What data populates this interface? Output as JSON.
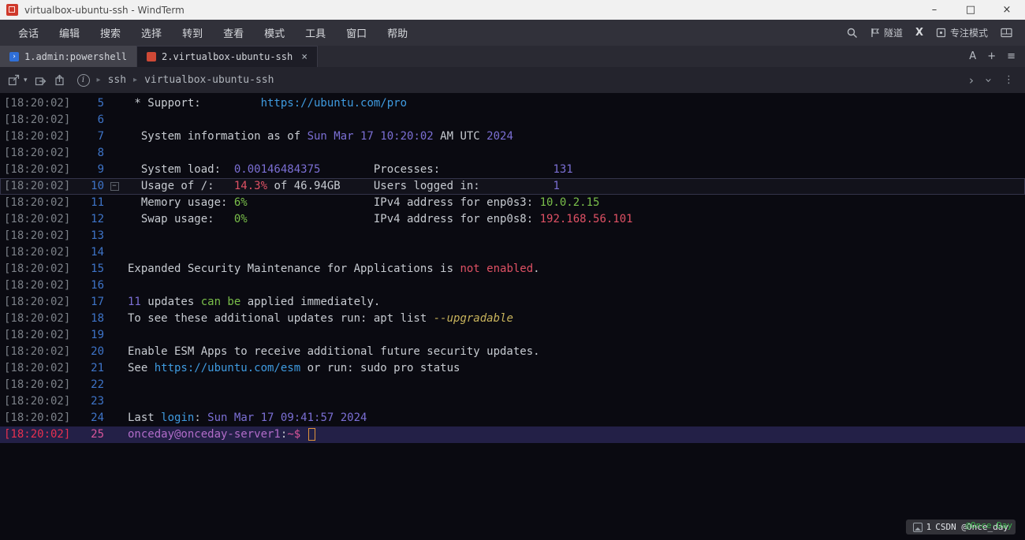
{
  "window": {
    "title": "virtualbox-ubuntu-ssh - WindTerm",
    "controls": {
      "minimize": "–",
      "maximize": "□",
      "close": "×"
    }
  },
  "menu": {
    "items": [
      "会话",
      "编辑",
      "搜索",
      "选择",
      "转到",
      "查看",
      "模式",
      "工具",
      "窗口",
      "帮助"
    ],
    "right": {
      "tunnel": "隧道",
      "x": "X",
      "focus": "专注模式"
    }
  },
  "tabs": {
    "items": [
      {
        "label": "1.admin:powershell",
        "icon": "powershell-icon",
        "icon_color": "#2f6fd8",
        "glyph": "›",
        "active": false
      },
      {
        "label": "2.virtualbox-ubuntu-ssh",
        "icon": "ssh-session-icon",
        "icon_color": "#cf4936",
        "glyph": "",
        "active": true,
        "close": "×"
      }
    ],
    "controls": {
      "font": "A",
      "add": "+",
      "list": "≡"
    }
  },
  "toolbar": {
    "breadcrumb": [
      "ssh",
      "virtualbox-ubuntu-ssh"
    ]
  },
  "terminal": {
    "timestamp": "[18:20:02]",
    "palette": {
      "fg": "#c7cbd1",
      "purple": "#7b6fd4",
      "blue": "#3f9be0",
      "green": "#7abf4a",
      "red": "#df5164",
      "pink": "#d9559a",
      "magenta": "#b16cc9",
      "yellow": "#c9b45c",
      "tsGray": "#7c8188",
      "tsRed": "#e83050",
      "lineno": "#3e74c8"
    },
    "lines": [
      {
        "no": "5",
        "segs": [
          [
            " * Support:         ",
            "fg"
          ],
          [
            "https://ubuntu.com/pro",
            "blue"
          ]
        ]
      },
      {
        "no": "6",
        "segs": []
      },
      {
        "no": "7",
        "segs": [
          [
            "  System information as of ",
            "fg"
          ],
          [
            "Sun Mar 17 10:20:02",
            "purple"
          ],
          [
            " AM UTC ",
            "fg"
          ],
          [
            "2024",
            "purple"
          ]
        ]
      },
      {
        "no": "8",
        "segs": []
      },
      {
        "no": "9",
        "segs": [
          [
            "  System load:  ",
            "fg"
          ],
          [
            "0.00146484375",
            "purple"
          ],
          [
            "        Processes:                 ",
            "fg"
          ],
          [
            "131",
            "purple"
          ]
        ]
      },
      {
        "no": "10",
        "fold": true,
        "hl": "box",
        "segs": [
          [
            "  Usage of /:   ",
            "fg"
          ],
          [
            "14.3%",
            "red"
          ],
          [
            " of 46.94GB",
            "fg"
          ],
          [
            "     Users logged in:           ",
            "fg"
          ],
          [
            "1",
            "purple"
          ]
        ]
      },
      {
        "no": "11",
        "segs": [
          [
            "  Memory usage: ",
            "fg"
          ],
          [
            "6%",
            "green"
          ],
          [
            "                   IPv4 address for enp0s3: ",
            "fg"
          ],
          [
            "10.0.2.15",
            "green"
          ]
        ]
      },
      {
        "no": "12",
        "segs": [
          [
            "  Swap usage:   ",
            "fg"
          ],
          [
            "0%",
            "green"
          ],
          [
            "                   IPv4 address for enp0s8: ",
            "fg"
          ],
          [
            "192.168.56.101",
            "red"
          ]
        ]
      },
      {
        "no": "13",
        "segs": []
      },
      {
        "no": "14",
        "segs": []
      },
      {
        "no": "15",
        "segs": [
          [
            "Expanded Security Maintenance for Applications is ",
            "fg"
          ],
          [
            "not enabled",
            "red"
          ],
          [
            ".",
            "fg"
          ]
        ]
      },
      {
        "no": "16",
        "segs": []
      },
      {
        "no": "17",
        "segs": [
          [
            "11",
            "purple"
          ],
          [
            " updates ",
            "fg"
          ],
          [
            "can be",
            "green"
          ],
          [
            " applied immediately.",
            "fg"
          ]
        ]
      },
      {
        "no": "18",
        "segs": [
          [
            "To see these additional updates run: apt list ",
            "fg"
          ],
          [
            "--upgradable",
            "yellow",
            "italic"
          ]
        ]
      },
      {
        "no": "19",
        "segs": []
      },
      {
        "no": "20",
        "segs": [
          [
            "Enable ESM Apps to receive additional future security updates.",
            "fg"
          ]
        ]
      },
      {
        "no": "21",
        "segs": [
          [
            "See ",
            "fg"
          ],
          [
            "https://ubuntu.com/esm",
            "blue"
          ],
          [
            " or run: sudo pro status",
            "fg"
          ]
        ]
      },
      {
        "no": "22",
        "segs": []
      },
      {
        "no": "23",
        "segs": []
      },
      {
        "no": "24",
        "segs": [
          [
            "Last ",
            "fg"
          ],
          [
            "login",
            "blue"
          ],
          [
            ": ",
            "fg"
          ],
          [
            "Sun Mar 17 09:41:57 2024",
            "purple"
          ]
        ]
      },
      {
        "no": "25",
        "tsColor": "tsRed",
        "noColor": "pink",
        "hl": "current",
        "segs": [
          [
            "onceday@onceday-server1",
            "magenta"
          ],
          [
            ":",
            "fg"
          ],
          [
            "~",
            "pink"
          ],
          [
            "$",
            "pink"
          ],
          [
            " ",
            "fg"
          ],
          [
            "",
            "cursor"
          ]
        ]
      }
    ]
  },
  "watermark": {
    "prefix": "1",
    "text": "CSDN @Once_day",
    "overlay": "@Once-Day"
  }
}
